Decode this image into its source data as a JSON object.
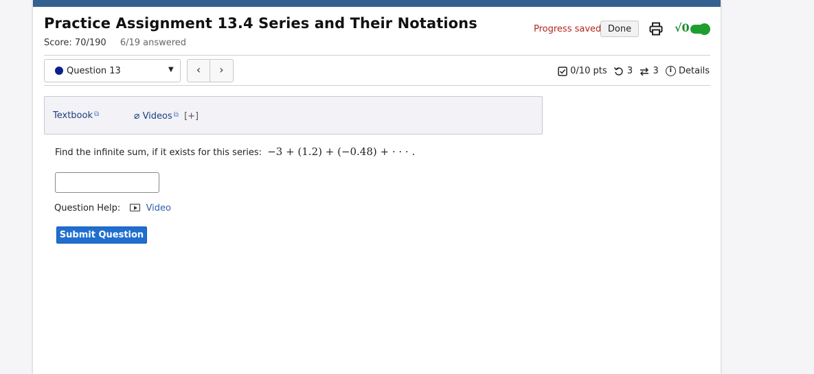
{
  "assignment": {
    "title": "Practice Assignment 13.4 Series and Their Notations",
    "score": "Score: 70/190",
    "answered": "6/19 answered"
  },
  "header": {
    "progress_saved": "Progress saved",
    "done_label": "Done",
    "sqrt_label": "√0"
  },
  "nav": {
    "question_label": "Question 13",
    "prev_label": "‹",
    "next_label": "›"
  },
  "status": {
    "points": "0/10 pts",
    "retries": "3",
    "attempts": "3",
    "details_label": "Details"
  },
  "resources": {
    "textbook_label": "Textbook",
    "videos_label": "Videos",
    "expand_label": "[+]"
  },
  "question": {
    "prompt": "Find the infinite sum, if it exists for this series:",
    "math": "−3 + (1.2) + (−0.48) + · · · .",
    "answer_value": ""
  },
  "help": {
    "label": "Question Help:",
    "video_label": "Video"
  },
  "submit_label": "Submit Question",
  "colors": {
    "topbar": "#356190",
    "progress_saved": "#b3261e",
    "toggle": "#1e9e2e",
    "submit": "#1f6fd0",
    "question_dot": "#0d1f8a"
  }
}
